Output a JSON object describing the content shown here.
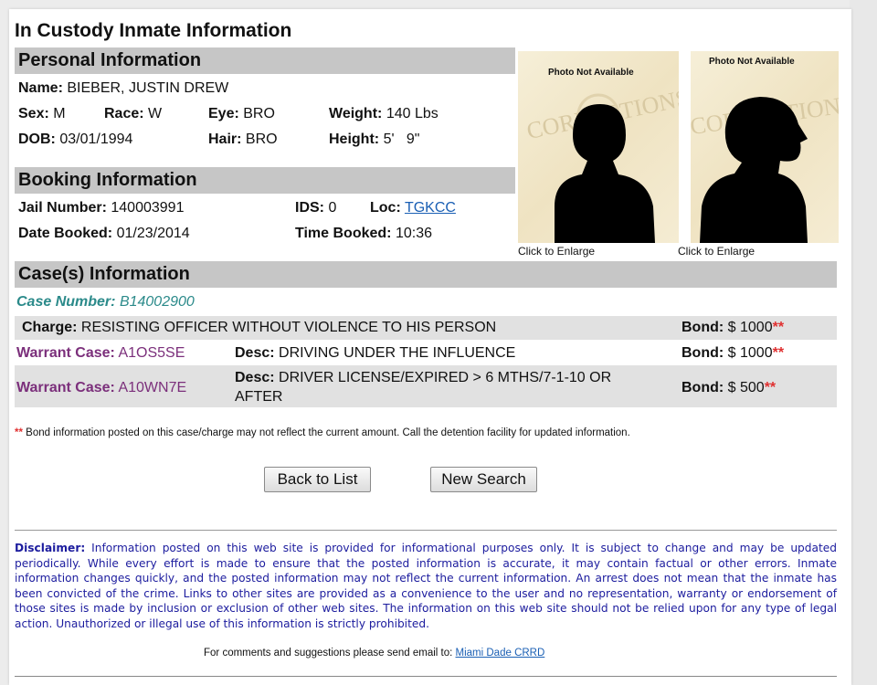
{
  "page_title": "In Custody Inmate Information",
  "personal": {
    "header": "Personal Information",
    "name_label": "Name:",
    "name": "BIEBER, JUSTIN DREW",
    "sex_label": "Sex:",
    "sex": "M",
    "race_label": "Race:",
    "race": "W",
    "eye_label": "Eye:",
    "eye": "BRO",
    "weight_label": "Weight:",
    "weight": "140 Lbs",
    "dob_label": "DOB:",
    "dob": "03/01/1994",
    "hair_label": "Hair:",
    "hair": "BRO",
    "height_label": "Height:",
    "height": "5'   9\""
  },
  "photos": {
    "front_not_available": "Photo Not Available",
    "side_not_available": "Photo Not Available",
    "front_enlarge": "Click to Enlarge",
    "side_enlarge": "Click to Enlarge",
    "watermark": "CORRECTIONS"
  },
  "booking": {
    "header": "Booking Information",
    "jail_number_label": "Jail Number:",
    "jail_number": "140003991",
    "ids_label": "IDS:",
    "ids": "0",
    "loc_label": "Loc:",
    "loc": "TGKCC",
    "date_booked_label": "Date Booked:",
    "date_booked": "01/23/2014",
    "time_booked_label": "Time Booked:",
    "time_booked": "10:36"
  },
  "cases": {
    "header": "Case(s) Information",
    "case_number_label": "Case Number:",
    "case_number": "B14002900",
    "charge_label": "Charge:",
    "charge": "RESISTING OFFICER WITHOUT VIOLENCE TO HIS PERSON",
    "charge_bond_label": "Bond:",
    "charge_bond": "$ 1000",
    "warrants": [
      {
        "label": "Warrant Case:",
        "case": "A1OS5SE",
        "desc_label": "Desc:",
        "desc": "DRIVING UNDER THE INFLUENCE",
        "bond_label": "Bond:",
        "bond": "$ 1000"
      },
      {
        "label": "Warrant Case:",
        "case": "A10WN7E",
        "desc_label": "Desc:",
        "desc_line1": "DRIVER LICENSE/EXPIRED > 6 MTHS/7-1-10 OR",
        "desc_line2": "AFTER",
        "bond_label": "Bond:",
        "bond": "$ 500"
      }
    ],
    "asterisk": "**",
    "bond_note": "Bond information posted on this case/charge may not reflect the current amount. Call the detention facility for updated information."
  },
  "buttons": {
    "back": "Back to List",
    "new_search": "New Search"
  },
  "footer": {
    "disclaimer_label": "Disclaimer:",
    "disclaimer_text": "Information posted on this web site is provided for informational purposes only. It is subject to change and may be updated periodically. While every effort is made to ensure that the posted information is accurate, it may contain factual or other errors. Inmate information changes quickly, and the posted information may not reflect the current information. An arrest does not mean that the inmate has been convicted of the crime. Links to other sites are provided as a convenience to the user and no representation, warranty or endorsement of those sites is made by inclusion or exclusion of other web sites. The information on this web site should not be relied upon for any type of legal action. Unauthorized or illegal use of this information is strictly prohibited.",
    "contact_text": "For comments and suggestions please send email to:",
    "contact_link": "Miami Dade CRRD"
  }
}
